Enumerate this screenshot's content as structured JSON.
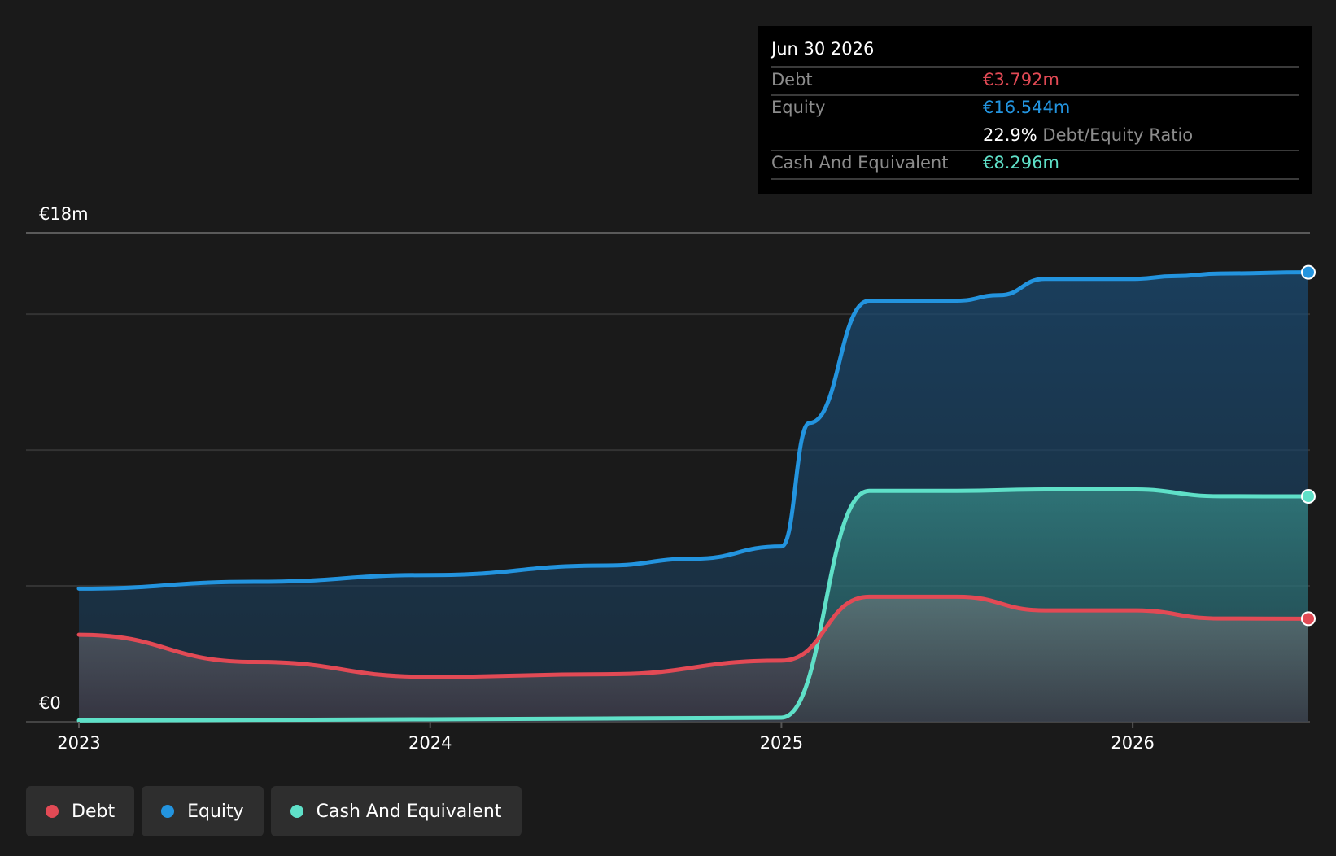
{
  "chart_data": {
    "type": "area",
    "title": "",
    "xlabel": "",
    "ylabel": "",
    "y_ticks_labeled": [
      "€0",
      "€18m"
    ],
    "ylim": [
      0,
      18
    ],
    "x_tick_labels": [
      "2023",
      "2024",
      "2025",
      "2026"
    ],
    "xlim": [
      2023.0,
      2026.5
    ],
    "grid": true,
    "legend_position": "bottom-left",
    "series": [
      {
        "name": "Equity",
        "color": "#2394df",
        "x": [
          2023.0,
          2023.5,
          2024.0,
          2024.5,
          2024.75,
          2025.0,
          2025.08,
          2025.25,
          2025.5,
          2025.62,
          2025.75,
          2026.0,
          2026.12,
          2026.25,
          2026.5
        ],
        "values": [
          4.9,
          5.15,
          5.4,
          5.75,
          6.0,
          6.45,
          11.0,
          15.5,
          15.5,
          15.7,
          16.3,
          16.3,
          16.4,
          16.5,
          16.544
        ]
      },
      {
        "name": "Cash And Equivalent",
        "color": "#5fe0c8",
        "x": [
          2023.0,
          2024.0,
          2025.0,
          2025.25,
          2025.5,
          2025.75,
          2026.0,
          2026.25,
          2026.5
        ],
        "values": [
          0.05,
          0.09,
          0.15,
          8.5,
          8.5,
          8.55,
          8.55,
          8.3,
          8.296
        ]
      },
      {
        "name": "Debt",
        "color": "#e24a55",
        "x": [
          2023.0,
          2023.5,
          2024.0,
          2024.5,
          2025.0,
          2025.25,
          2025.5,
          2025.75,
          2026.0,
          2026.25,
          2026.5
        ],
        "values": [
          3.2,
          2.2,
          1.65,
          1.75,
          2.25,
          4.6,
          4.6,
          4.1,
          4.1,
          3.8,
          3.792
        ]
      }
    ]
  },
  "tooltip": {
    "date": "Jun 30 2026",
    "debt_label": "Debt",
    "debt_value": "€3.792m",
    "equity_label": "Equity",
    "equity_value": "€16.544m",
    "ratio_value": "22.9%",
    "ratio_label": "Debt/Equity Ratio",
    "cash_label": "Cash And Equivalent",
    "cash_value": "€8.296m"
  },
  "legend": [
    {
      "label": "Debt",
      "color": "#e24a55"
    },
    {
      "label": "Equity",
      "color": "#2394df"
    },
    {
      "label": "Cash And Equivalent",
      "color": "#5fe0c8"
    }
  ]
}
